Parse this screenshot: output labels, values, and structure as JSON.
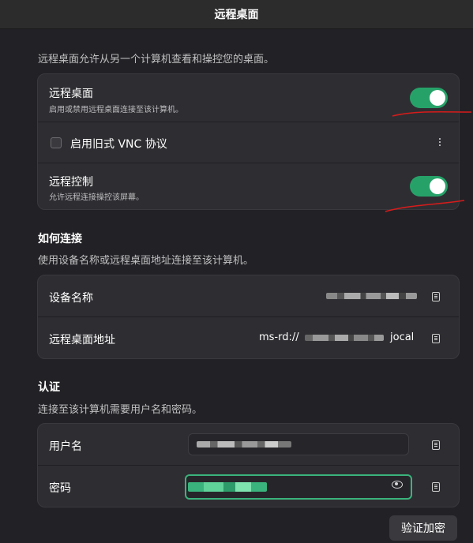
{
  "window": {
    "title": "远程桌面"
  },
  "intro": {
    "description": "远程桌面允许从另一个计算机查看和操控您的桌面。"
  },
  "remote_desktop_card": {
    "remote_desktop": {
      "label": "远程桌面",
      "subtitle": "启用或禁用远程桌面连接至该计算机。",
      "enabled": true
    },
    "legacy_vnc": {
      "label": "启用旧式 VNC 协议",
      "checked": false
    },
    "remote_control": {
      "label": "远程控制",
      "subtitle": "允许远程连接操控该屏幕。",
      "enabled": true
    }
  },
  "how_to_connect": {
    "heading": "如何连接",
    "description": "使用设备名称或远程桌面地址连接至该计算机。",
    "device_name": {
      "label": "设备名称",
      "value": ""
    },
    "address": {
      "label": "远程桌面地址",
      "value_prefix": "ms-rd://",
      "value_suffix": "jocal"
    }
  },
  "authentication": {
    "heading": "认证",
    "description": "连接至该计算机需要用户名和密码。",
    "username": {
      "label": "用户名",
      "value": ""
    },
    "password": {
      "label": "密码",
      "value": ""
    }
  },
  "actions": {
    "verify_encryption": "验证加密"
  },
  "colors": {
    "accent": "#26a269",
    "background": "#222226",
    "card": "#2e2e32"
  }
}
